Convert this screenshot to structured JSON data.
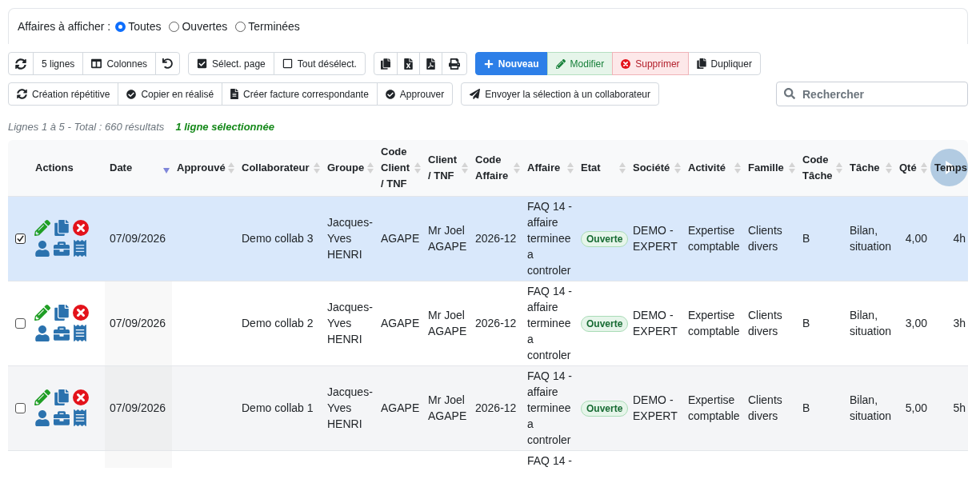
{
  "filter": {
    "label": "Affaires à afficher :",
    "options": [
      {
        "label": "Toutes",
        "selected": true
      },
      {
        "label": "Ouvertes",
        "selected": false
      },
      {
        "label": "Terminées",
        "selected": false
      }
    ]
  },
  "toolbars": [
    {
      "groups": [
        {
          "buttons": [
            {
              "kind": "plain"
            },
            {
              "kind": "plain",
              "label": "5 lignes"
            },
            {
              "kind": "plain",
              "label": "Colonnes"
            },
            {
              "kind": "plain"
            }
          ]
        },
        {
          "buttons": [
            {
              "kind": "plain",
              "label": "Sélect. page"
            },
            {
              "kind": "plain",
              "label": "Tout désélect."
            }
          ]
        },
        {
          "buttons": [
            {
              "kind": "plain"
            },
            {
              "kind": "plain"
            },
            {
              "kind": "plain"
            },
            {
              "kind": "plain"
            }
          ]
        },
        {
          "buttons": [
            {
              "kind": "primary",
              "label": "Nouveau"
            },
            {
              "kind": "success",
              "label": "Modifier"
            },
            {
              "kind": "danger",
              "label": "Supprimer"
            },
            {
              "kind": "plain",
              "label": "Dupliquer"
            }
          ]
        }
      ]
    },
    {
      "groups": [
        {
          "buttons": [
            {
              "kind": "plain",
              "label": "Création répétitive"
            },
            {
              "kind": "plain",
              "label": "Copier en réalisé"
            },
            {
              "kind": "plain",
              "label": "Créer facture correspondante"
            },
            {
              "kind": "plain",
              "label": "Approuver"
            }
          ]
        },
        {
          "buttons": [
            {
              "kind": "plain",
              "label": "Envoyer la sélection à un collaborateur"
            }
          ]
        }
      ]
    }
  ],
  "search": {
    "placeholder": "Rechercher"
  },
  "summary": {
    "text": "Lignes 1 à 5 - Total : 660 résultats",
    "selection": "1 ligne sélectionnée"
  },
  "table": {
    "columns": [
      {
        "label": "Actions",
        "sortable": false
      },
      {
        "label": "Date",
        "sortable": true,
        "sorted": true
      },
      {
        "label": "Approuvé",
        "sortable": true,
        "sorted": false
      },
      {
        "label": "Collaborateur",
        "sortable": true,
        "sorted": false
      },
      {
        "label": "Groupe",
        "sortable": true,
        "sorted": false
      },
      {
        "label": "Code Client / TNF",
        "sortable": true,
        "sorted": false
      },
      {
        "label": "Client / TNF",
        "sortable": true,
        "sorted": false
      },
      {
        "label": "Code Affaire",
        "sortable": true,
        "sorted": false
      },
      {
        "label": "Affaire",
        "sortable": true,
        "sorted": false
      },
      {
        "label": "Etat",
        "sortable": true,
        "sorted": false
      },
      {
        "label": "Société",
        "sortable": true,
        "sorted": false
      },
      {
        "label": "Activité",
        "sortable": true,
        "sorted": false
      },
      {
        "label": "Famille",
        "sortable": true,
        "sorted": false
      },
      {
        "label": "Code Tâche",
        "sortable": true,
        "sorted": false
      },
      {
        "label": "Tâche",
        "sortable": true,
        "sorted": false
      },
      {
        "label": "Qté",
        "sortable": true,
        "sorted": false
      },
      {
        "label": "Temps"
      }
    ],
    "rows": [
      {
        "kind": "record",
        "selected": true,
        "date": "07/09/2026",
        "collaborateur": "Demo collab 3",
        "groupe": "Jacques-Yves HENRI",
        "code_client": "AGAPE",
        "client": "Mr Joel AGAPE",
        "code_affaire": "2026-12",
        "affaire": "FAQ 14 - affaire terminee a controler",
        "etat": "Ouverte",
        "societe": "DEMO - EXPERT",
        "activite": "Expertise comptable",
        "famille": "Clients divers",
        "code_tache": "B",
        "tache": "Bilan, situation",
        "qte": "4,00",
        "temps": "4h"
      },
      {
        "kind": "record",
        "selected": false,
        "date": "07/09/2026",
        "collaborateur": "Demo collab 2",
        "groupe": "Jacques-Yves HENRI",
        "code_client": "AGAPE",
        "client": "Mr Joel AGAPE",
        "code_affaire": "2026-12",
        "affaire": "FAQ 14 - affaire terminee a controler",
        "etat": "Ouverte",
        "societe": "DEMO - EXPERT",
        "activite": "Expertise comptable",
        "famille": "Clients divers",
        "code_tache": "B",
        "tache": "Bilan, situation",
        "qte": "3,00",
        "temps": "3h"
      },
      {
        "kind": "record",
        "selected": false,
        "date": "07/09/2026",
        "collaborateur": "Demo collab 1",
        "groupe": "Jacques-Yves HENRI",
        "code_client": "AGAPE",
        "client": "Mr Joel AGAPE",
        "code_affaire": "2026-12",
        "affaire": "FAQ 14 - affaire terminee a controler",
        "etat": "Ouverte",
        "societe": "DEMO - EXPERT",
        "activite": "Expertise comptable",
        "famille": "Clients divers",
        "code_tache": "B",
        "tache": "Bilan, situation",
        "qte": "5,00",
        "temps": "5h"
      },
      {
        "kind": "cut",
        "selected": false,
        "affaire": "FAQ 14 -"
      }
    ]
  }
}
